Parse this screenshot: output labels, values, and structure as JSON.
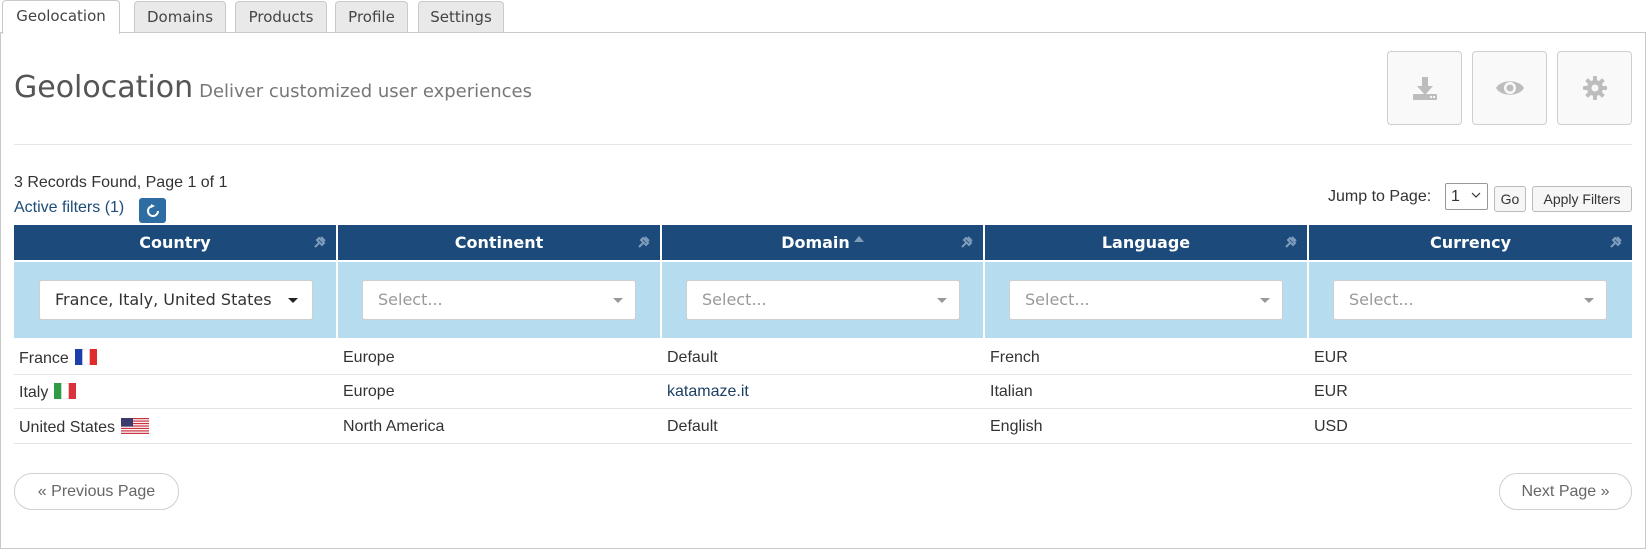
{
  "tabs": [
    {
      "label": "Geolocation",
      "active": true
    },
    {
      "label": "Domains",
      "active": false
    },
    {
      "label": "Products",
      "active": false
    },
    {
      "label": "Profile",
      "active": false
    },
    {
      "label": "Settings",
      "active": false
    }
  ],
  "header": {
    "title": "Geolocation",
    "subtitle": "Deliver customized user experiences",
    "actions": [
      "download-icon",
      "eye-icon",
      "gear-icon"
    ]
  },
  "summary": {
    "records": "3 Records Found, Page 1 of 1",
    "active_filters": "Active filters (1)",
    "jump_label": "Jump to Page:",
    "jump_value": "1",
    "go_label": "Go",
    "apply_label": "Apply Filters"
  },
  "table": {
    "columns": [
      "Country",
      "Continent",
      "Domain",
      "Language",
      "Currency"
    ],
    "sorted_column": "Domain",
    "filters": [
      "France, Italy, United States",
      "Select...",
      "Select...",
      "Select...",
      "Select..."
    ],
    "rows": [
      {
        "country": "France",
        "flag": "france",
        "continent": "Europe",
        "domain": "Default",
        "language": "French",
        "currency": "EUR"
      },
      {
        "country": "Italy",
        "flag": "italy",
        "continent": "Europe",
        "domain": "katamaze.it",
        "language": "Italian",
        "currency": "EUR"
      },
      {
        "country": "United States",
        "flag": "usa",
        "continent": "North America",
        "domain": "Default",
        "language": "English",
        "currency": "USD"
      }
    ]
  },
  "pagination": {
    "previous": "« Previous Page",
    "next": "Next Page »"
  },
  "colors": {
    "header_bg": "#1b4a7b",
    "filter_bg": "#b6dcef",
    "refresh_btn": "#2e6da4"
  }
}
